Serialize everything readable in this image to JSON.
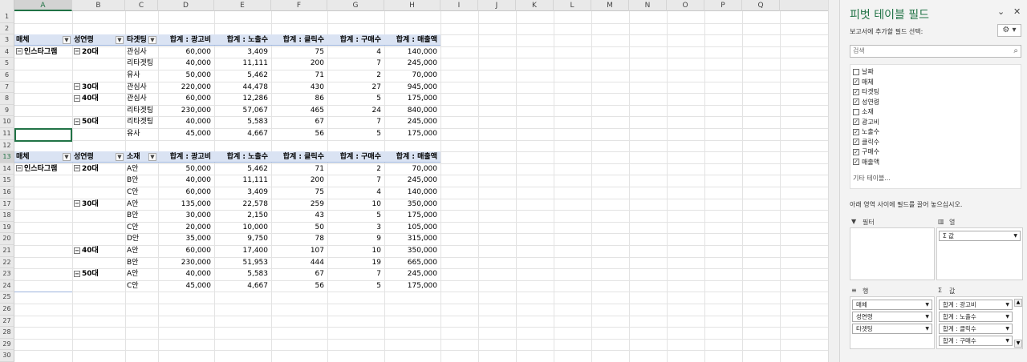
{
  "columns": [
    "A",
    "B",
    "C",
    "D",
    "E",
    "F",
    "G",
    "H",
    "I",
    "J",
    "K",
    "L",
    "M",
    "N",
    "O",
    "P",
    "Q"
  ],
  "rows": [
    "1",
    "2",
    "3",
    "4",
    "5",
    "6",
    "7",
    "8",
    "9",
    "10",
    "11",
    "12",
    "13",
    "14",
    "15",
    "16",
    "17",
    "18",
    "19",
    "20",
    "21",
    "22",
    "23",
    "24",
    "25",
    "26",
    "27",
    "28",
    "29",
    "30"
  ],
  "pivot1": {
    "headers": [
      "매체",
      "성연령",
      "타겟팅",
      "합계 : 광고비",
      "합계 : 노출수",
      "합계 : 클릭수",
      "합계 : 구매수",
      "합계 : 매출액"
    ],
    "rows": [
      [
        "인스타그램",
        "20대",
        "관심사",
        "60,000",
        "3,409",
        "75",
        "4",
        "140,000"
      ],
      [
        "",
        "",
        "리타겟팅",
        "40,000",
        "11,111",
        "200",
        "7",
        "245,000"
      ],
      [
        "",
        "",
        "유사",
        "50,000",
        "5,462",
        "71",
        "2",
        "70,000"
      ],
      [
        "",
        "30대",
        "관심사",
        "220,000",
        "44,478",
        "430",
        "27",
        "945,000"
      ],
      [
        "",
        "40대",
        "관심사",
        "60,000",
        "12,286",
        "86",
        "5",
        "175,000"
      ],
      [
        "",
        "",
        "리타겟팅",
        "230,000",
        "57,067",
        "465",
        "24",
        "840,000"
      ],
      [
        "",
        "50대",
        "리타겟팅",
        "40,000",
        "5,583",
        "67",
        "7",
        "245,000"
      ],
      [
        "",
        "",
        "유사",
        "45,000",
        "4,667",
        "56",
        "5",
        "175,000"
      ]
    ]
  },
  "pivot2": {
    "headers": [
      "매체",
      "성연령",
      "소재",
      "합계 : 광고비",
      "합계 : 노출수",
      "합계 : 클릭수",
      "합계 : 구매수",
      "합계 : 매출액"
    ],
    "rows": [
      [
        "인스타그램",
        "20대",
        "A안",
        "50,000",
        "5,462",
        "71",
        "2",
        "70,000"
      ],
      [
        "",
        "",
        "B안",
        "40,000",
        "11,111",
        "200",
        "7",
        "245,000"
      ],
      [
        "",
        "",
        "C안",
        "60,000",
        "3,409",
        "75",
        "4",
        "140,000"
      ],
      [
        "",
        "30대",
        "A안",
        "135,000",
        "22,578",
        "259",
        "10",
        "350,000"
      ],
      [
        "",
        "",
        "B안",
        "30,000",
        "2,150",
        "43",
        "5",
        "175,000"
      ],
      [
        "",
        "",
        "C안",
        "20,000",
        "10,000",
        "50",
        "3",
        "105,000"
      ],
      [
        "",
        "",
        "D안",
        "35,000",
        "9,750",
        "78",
        "9",
        "315,000"
      ],
      [
        "",
        "40대",
        "A안",
        "60,000",
        "17,400",
        "107",
        "10",
        "350,000"
      ],
      [
        "",
        "",
        "B안",
        "230,000",
        "51,953",
        "444",
        "19",
        "665,000"
      ],
      [
        "",
        "50대",
        "A안",
        "40,000",
        "5,583",
        "67",
        "7",
        "245,000"
      ],
      [
        "",
        "",
        "C안",
        "45,000",
        "4,667",
        "56",
        "5",
        "175,000"
      ]
    ]
  },
  "pane": {
    "title": "피벗 테이블 필드",
    "subtitle": "보고서에 추가할 필드 선택:",
    "search_placeholder": "검색",
    "fields": [
      {
        "label": "날짜",
        "checked": false
      },
      {
        "label": "매체",
        "checked": true
      },
      {
        "label": "타겟팅",
        "checked": true
      },
      {
        "label": "성연령",
        "checked": true
      },
      {
        "label": "소재",
        "checked": false
      },
      {
        "label": "광고비",
        "checked": true
      },
      {
        "label": "노출수",
        "checked": true
      },
      {
        "label": "클릭수",
        "checked": true
      },
      {
        "label": "구매수",
        "checked": true
      },
      {
        "label": "매출액",
        "checked": true
      }
    ],
    "more_tables": "기타 테이블...",
    "drag_hint": "아래 영역 사이에 필드를 끌어 놓으십시오.",
    "filter_label": "필터",
    "columns_label": "열",
    "rows_label": "행",
    "values_label": "값",
    "columns_pill": "Σ 값",
    "row_pills": [
      "매체",
      "성연령",
      "타겟팅"
    ],
    "value_pills": [
      "합계 : 광고비",
      "합계 : 노출수",
      "합계 : 클릭수",
      "합계 : 구매수"
    ]
  }
}
